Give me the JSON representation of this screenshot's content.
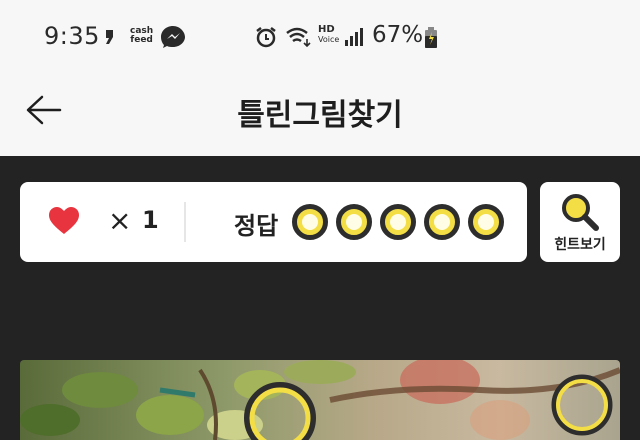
{
  "status_bar": {
    "time": "9:35",
    "battery": "67%",
    "cash_feed_line1": "cash",
    "cash_feed_line2": "feed",
    "hd_line1": "HD",
    "hd_line2": "Voice",
    "icons": [
      "notification-icon",
      "cashfeed-icon",
      "messenger-icon",
      "alarm-icon",
      "wifi-icon",
      "hd-voice-icon",
      "signal-icon",
      "battery-icon"
    ]
  },
  "header": {
    "title": "틀린그림찾기",
    "back_icon": "back-arrow-icon"
  },
  "score": {
    "lives_symbol": "×",
    "lives": "1",
    "answer_label": "정답",
    "answer_slots": 5,
    "found": 0
  },
  "hint": {
    "label": "힌트보기",
    "icon": "magnifier-icon"
  },
  "colors": {
    "accent_yellow": "#f3de46",
    "heart_red": "#e8343e",
    "dark_bg": "#232323",
    "header_bg": "#f7f7f7"
  }
}
